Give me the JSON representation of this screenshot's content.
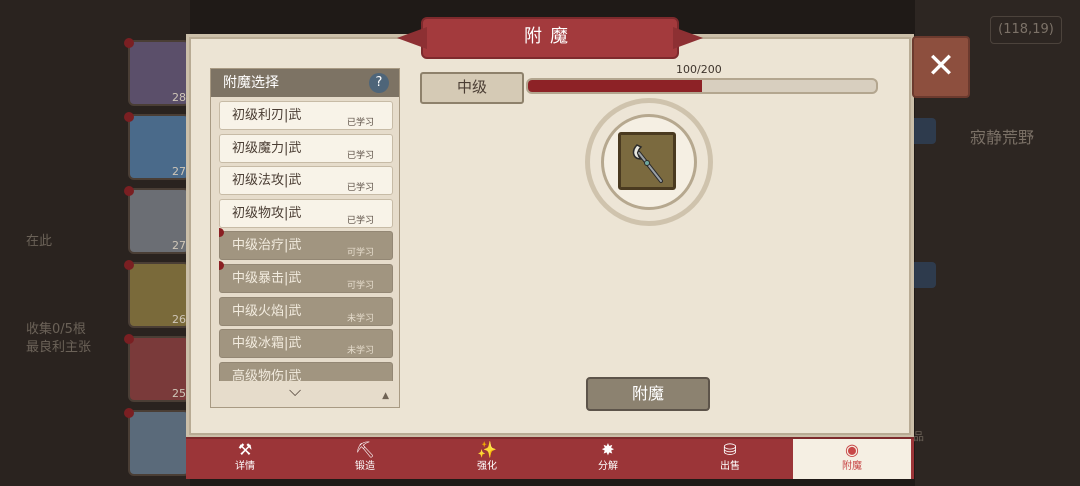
{
  "window": {
    "title": "附魔",
    "close_label": "✕"
  },
  "background": {
    "coord": "(118,19)",
    "side_text": "寂静荒野",
    "portraits": [
      {
        "level": "28"
      },
      {
        "level": "27"
      },
      {
        "level": "27"
      },
      {
        "level": "26"
      },
      {
        "level": "25"
      },
      {
        "level": ""
      }
    ],
    "left_text": [
      "在此",
      "收集0/5根",
      "最良利主张"
    ],
    "right_label": "物品"
  },
  "enchant_list": {
    "header": "附魔选择",
    "help": "?",
    "items": [
      {
        "name": "初级利刃|武",
        "status": "已学习",
        "state": "learned",
        "dot": false
      },
      {
        "name": "初级魔力|武",
        "status": "已学习",
        "state": "learned",
        "dot": false
      },
      {
        "name": "初级法攻|武",
        "status": "已学习",
        "state": "learned",
        "dot": false
      },
      {
        "name": "初级物攻|武",
        "status": "已学习",
        "state": "learned",
        "dot": false
      },
      {
        "name": "中级治疗|武",
        "status": "可学习",
        "state": "learnable",
        "dot": true
      },
      {
        "name": "中级暴击|武",
        "status": "可学习",
        "state": "learnable",
        "dot": true
      },
      {
        "name": "中级火焰|武",
        "status": "未学习",
        "state": "locked",
        "dot": false
      },
      {
        "name": "中级冰霜|武",
        "status": "未学习",
        "state": "locked",
        "dot": false
      },
      {
        "name": "高级物伤|武",
        "status": "",
        "state": "locked",
        "dot": false
      }
    ]
  },
  "level": {
    "label": "中级",
    "progress_text": "100/200",
    "progress_fraction": 0.5
  },
  "selected_item": {
    "icon": "weapon-scythe-icon"
  },
  "enchant_button": "附魔",
  "tabs": [
    {
      "label": "详情",
      "icon": "hammer-icon",
      "active": false
    },
    {
      "label": "锻造",
      "icon": "anvil-icon",
      "active": false
    },
    {
      "label": "强化",
      "icon": "sparkle-wand-icon",
      "active": false
    },
    {
      "label": "分解",
      "icon": "burst-icon",
      "active": false
    },
    {
      "label": "出售",
      "icon": "coins-icon",
      "active": false
    },
    {
      "label": "附魔",
      "icon": "eye-sigil-icon",
      "active": true
    }
  ],
  "colors": {
    "accent": "#9b3538",
    "panel": "#ece4d4",
    "progress": "#8d2226"
  }
}
